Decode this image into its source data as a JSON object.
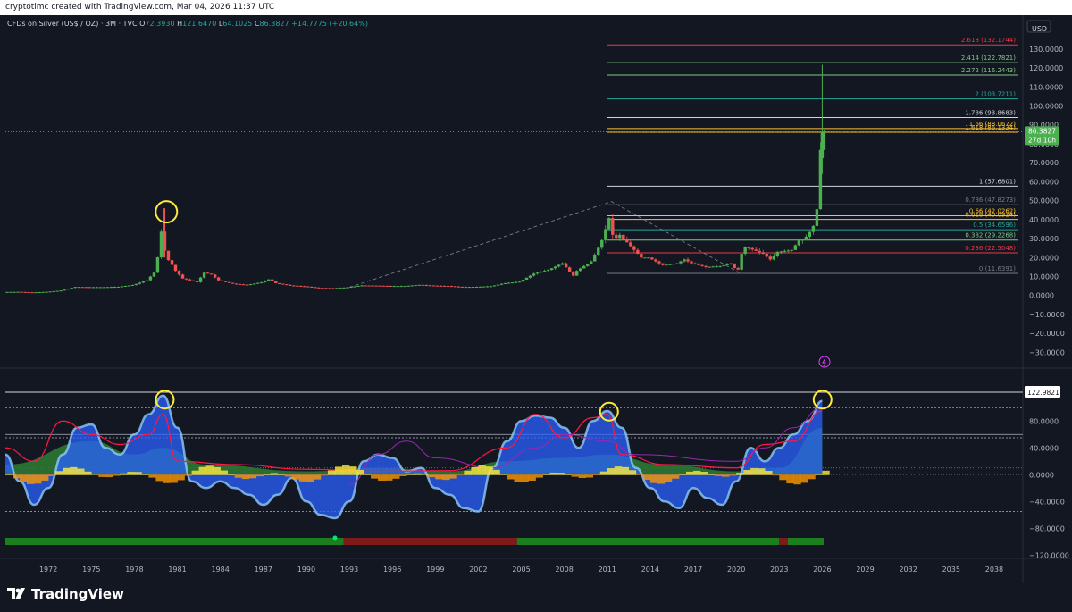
{
  "header": {
    "credit": "cryptotimc created with TradingView.com, Mar 04, 2026 11:37 UTC"
  },
  "symbol_line": {
    "name": "CFDs on Silver (US$ / OZ) · 3M · TVC",
    "o_label": "O",
    "o_value": "72.3930",
    "h_label": "H",
    "h_value": "121.6470",
    "l_label": "L",
    "l_value": "64.1025",
    "c_label": "C",
    "c_value": "86.3827",
    "change": "+14.7775 (+20.64%)"
  },
  "logo": {
    "text": "TradingView"
  },
  "colors": {
    "background": "#131722",
    "up": "#4caf50",
    "down": "#ef5350",
    "fib_red": "#f23645",
    "fib_green": "#81c784",
    "fib_teal": "#26a69a",
    "fib_yellow": "#fbc02d",
    "fib_white": "#d1d4dc",
    "fib_gray": "#787b86",
    "osc_blue": "#2962ff",
    "osc_lightblue": "#90caf9",
    "osc_green": "#4caf50",
    "osc_yellow": "#ffeb3b",
    "osc_red": "#ff1744",
    "osc_purple": "#9c27b0",
    "annotation": "#ffeb3b"
  },
  "chart_data": [
    {
      "type": "candlestick",
      "title": "CFDs on Silver (US$ / OZ) · 3M · TVC",
      "currency_label": "USD",
      "ylim": [
        -35,
        137
      ],
      "xlim": [
        1969.0,
        2040.0
      ],
      "y_ticks": [
        "130.0000",
        "120.0000",
        "110.0000",
        "100.0000",
        "90.0000",
        "80.0000",
        "70.0000",
        "60.0000",
        "50.0000",
        "40.0000",
        "30.0000",
        "20.0000",
        "10.0000",
        "0.0000",
        "−10.0000",
        "−20.0000",
        "−30.0000"
      ],
      "y_tick_values": [
        130,
        120,
        110,
        100,
        90,
        80,
        70,
        60,
        50,
        40,
        30,
        20,
        10,
        0,
        -10,
        -20,
        -30
      ],
      "last_price_label": "86.3827",
      "countdown_label": "27d 10h",
      "last_price": 86.3827,
      "series": [
        {
          "name": "price",
          "points": [
            [
              1969.0,
              1.8
            ],
            [
              1970.0,
              1.9
            ],
            [
              1971.0,
              1.6
            ],
            [
              1972.0,
              1.9
            ],
            [
              1973.0,
              2.6
            ],
            [
              1974.0,
              4.5
            ],
            [
              1975.0,
              4.4
            ],
            [
              1976.0,
              4.4
            ],
            [
              1977.0,
              4.6
            ],
            [
              1978.0,
              5.5
            ],
            [
              1979.0,
              8.0
            ],
            [
              1979.5,
              12.0
            ],
            [
              1979.9,
              25
            ],
            [
              1980.05,
              38
            ],
            [
              1980.3,
              20
            ],
            [
              1980.6,
              18
            ],
            [
              1981.0,
              13
            ],
            [
              1981.5,
              9
            ],
            [
              1982.0,
              8
            ],
            [
              1982.5,
              7
            ],
            [
              1983.0,
              12
            ],
            [
              1983.5,
              11
            ],
            [
              1984.0,
              8
            ],
            [
              1985.0,
              6.2
            ],
            [
              1986.0,
              5.6
            ],
            [
              1987.0,
              7.0
            ],
            [
              1987.5,
              8.5
            ],
            [
              1988.0,
              6.5
            ],
            [
              1989.0,
              5.3
            ],
            [
              1990.0,
              4.8
            ],
            [
              1991.0,
              4.0
            ],
            [
              1992.0,
              3.8
            ],
            [
              1993.0,
              4.3
            ],
            [
              1994.0,
              5.3
            ],
            [
              1995.0,
              5.2
            ],
            [
              1996.0,
              5.0
            ],
            [
              1997.0,
              5.0
            ],
            [
              1998.0,
              5.6
            ],
            [
              1999.0,
              5.2
            ],
            [
              2000.0,
              5.0
            ],
            [
              2001.0,
              4.5
            ],
            [
              2002.0,
              4.6
            ],
            [
              2003.0,
              4.9
            ],
            [
              2004.0,
              6.5
            ],
            [
              2005.0,
              7.3
            ],
            [
              2006.0,
              11.5
            ],
            [
              2007.0,
              13.5
            ],
            [
              2008.0,
              17
            ],
            [
              2008.8,
              10
            ],
            [
              2009.0,
              13
            ],
            [
              2010.0,
              18
            ],
            [
              2010.7,
              28
            ],
            [
              2011.0,
              35
            ],
            [
              2011.3,
              42
            ],
            [
              2011.5,
              32
            ],
            [
              2011.8,
              30
            ],
            [
              2012.0,
              32
            ],
            [
              2012.5,
              28
            ],
            [
              2013.0,
              24
            ],
            [
              2013.5,
              20
            ],
            [
              2014.0,
              20
            ],
            [
              2015.0,
              16
            ],
            [
              2016.0,
              17
            ],
            [
              2016.5,
              19
            ],
            [
              2017.0,
              17
            ],
            [
              2018.0,
              15
            ],
            [
              2019.0,
              15.5
            ],
            [
              2019.8,
              17
            ],
            [
              2020.2,
              12
            ],
            [
              2020.5,
              22
            ],
            [
              2020.8,
              26
            ],
            [
              2021.0,
              25
            ],
            [
              2022.0,
              22
            ],
            [
              2022.5,
              19
            ],
            [
              2023.0,
              23
            ],
            [
              2024.0,
              24
            ],
            [
              2024.5,
              29
            ],
            [
              2025.0,
              31
            ],
            [
              2025.3,
              34
            ],
            [
              2025.6,
              38
            ],
            [
              2025.8,
              48
            ],
            [
              2025.95,
              72
            ],
            [
              2026.1,
              86.3827
            ]
          ]
        }
      ],
      "fib_levels": [
        {
          "ratio": "2.618",
          "label": "2.618 (132.1744)",
          "value": 132.1744,
          "color": "#f23645"
        },
        {
          "ratio": "2.414",
          "label": "2.414 (122.7821)",
          "value": 122.7821,
          "color": "#81c784"
        },
        {
          "ratio": "2.272",
          "label": "2.272 (116.2443)",
          "value": 116.2443,
          "color": "#81c784"
        },
        {
          "ratio": "2",
          "label": "2 (103.7211)",
          "value": 103.7211,
          "color": "#26a69a"
        },
        {
          "ratio": "1.786",
          "label": "1.786 (93.8683)",
          "value": 93.8683,
          "color": "#d1d4dc"
        },
        {
          "ratio": "1.66",
          "label": "1.66 (88.0672)",
          "value": 88.0672,
          "color": "#fbc02d"
        },
        {
          "ratio": "1.618",
          "label": "1.618 (86.1334)",
          "value": 86.1334,
          "color": "#fbc02d"
        },
        {
          "ratio": "1",
          "label": "1 (57.6801)",
          "value": 57.6801,
          "color": "#d1d4dc"
        },
        {
          "ratio": "0.786",
          "label": "0.786 (47.8273)",
          "value": 47.8273,
          "color": "#787b86"
        },
        {
          "ratio": "0.66",
          "label": "0.66 (42.0262)",
          "value": 42.0262,
          "color": "#fbc02d"
        },
        {
          "ratio": "0.618",
          "label": "0.618 (40.0924)",
          "value": 40.0924,
          "color": "#fbc02d"
        },
        {
          "ratio": "0.5",
          "label": "0.5 (34.6596)",
          "value": 34.6596,
          "color": "#26a69a"
        },
        {
          "ratio": "0.382",
          "label": "0.382 (29.2268)",
          "value": 29.2268,
          "color": "#81c784"
        },
        {
          "ratio": "0.236",
          "label": "0.236 (22.5048)",
          "value": 22.5048,
          "color": "#f23645"
        },
        {
          "ratio": "0",
          "label": "0 (11.6391)",
          "value": 11.6391,
          "color": "#787b86"
        }
      ],
      "fib_x_range": [
        2011.0,
        2040.0
      ],
      "trend_line": [
        [
          1993.0,
          4.3
        ],
        [
          2011.3,
          49.5
        ],
        [
          2020.2,
          12.0
        ]
      ],
      "annotations": [
        {
          "type": "circle",
          "x": 1980.05,
          "y": 46
        }
      ]
    },
    {
      "type": "area",
      "title": "oscillator",
      "ylim": [
        -125,
        135
      ],
      "y_ticks": [
        "80.0000",
        "40.0000",
        "0.0000",
        "−40.0000",
        "−80.0000",
        "−120.0000"
      ],
      "y_tick_values": [
        80,
        40,
        0,
        -40,
        -80,
        -120
      ],
      "value_label": "122.9821",
      "value": 122.9821,
      "levels": [
        122.98,
        100,
        60,
        55,
        10,
        -55
      ],
      "series": [
        {
          "name": "wave",
          "points": [
            [
              1969,
              30
            ],
            [
              1970,
              -10
            ],
            [
              1971,
              -45
            ],
            [
              1972,
              -20
            ],
            [
              1973,
              30
            ],
            [
              1974,
              70
            ],
            [
              1975,
              75
            ],
            [
              1976,
              40
            ],
            [
              1977,
              30
            ],
            [
              1978,
              60
            ],
            [
              1979,
              90
            ],
            [
              1980,
              118
            ],
            [
              1981,
              70
            ],
            [
              1982,
              -10
            ],
            [
              1983,
              -20
            ],
            [
              1984,
              -10
            ],
            [
              1985,
              -20
            ],
            [
              1986,
              -30
            ],
            [
              1987,
              -45
            ],
            [
              1988,
              -30
            ],
            [
              1989,
              -5
            ],
            [
              1990,
              -40
            ],
            [
              1991,
              -60
            ],
            [
              1992,
              -65
            ],
            [
              1993,
              -40
            ],
            [
              1994,
              20
            ],
            [
              1995,
              30
            ],
            [
              1996,
              25
            ],
            [
              1997,
              5
            ],
            [
              1998,
              10
            ],
            [
              1999,
              -20
            ],
            [
              2000,
              -30
            ],
            [
              2001,
              -50
            ],
            [
              2002,
              -55
            ],
            [
              2003,
              10
            ],
            [
              2004,
              50
            ],
            [
              2005,
              80
            ],
            [
              2006,
              88
            ],
            [
              2007,
              85
            ],
            [
              2008,
              70
            ],
            [
              2009,
              40
            ],
            [
              2010,
              80
            ],
            [
              2011,
              95
            ],
            [
              2012,
              70
            ],
            [
              2013,
              10
            ],
            [
              2014,
              -20
            ],
            [
              2015,
              -40
            ],
            [
              2016,
              -50
            ],
            [
              2017,
              -20
            ],
            [
              2018,
              -35
            ],
            [
              2019,
              -45
            ],
            [
              2020,
              -10
            ],
            [
              2021,
              40
            ],
            [
              2022,
              20
            ],
            [
              2023,
              40
            ],
            [
              2024,
              60
            ],
            [
              2025,
              80
            ],
            [
              2026,
              110
            ]
          ]
        },
        {
          "name": "green",
          "points": [
            [
              1969,
              15
            ],
            [
              1975,
              50
            ],
            [
              1978,
              30
            ],
            [
              1980,
              40
            ],
            [
              1983,
              15
            ],
            [
              1990,
              5
            ],
            [
              1995,
              10
            ],
            [
              2000,
              5
            ],
            [
              2004,
              20
            ],
            [
              2008,
              25
            ],
            [
              2011,
              30
            ],
            [
              2015,
              15
            ],
            [
              2020,
              5
            ],
            [
              2023,
              10
            ],
            [
              2026,
              70
            ]
          ]
        },
        {
          "name": "red",
          "points": [
            [
              1969,
              40
            ],
            [
              1971,
              20
            ],
            [
              1973,
              80
            ],
            [
              1975,
              60
            ],
            [
              1977,
              45
            ],
            [
              1979,
              60
            ],
            [
              1980,
              90
            ],
            [
              1981,
              20
            ],
            [
              1985,
              15
            ],
            [
              1990,
              8
            ],
            [
              1995,
              5
            ],
            [
              2000,
              6
            ],
            [
              2004,
              40
            ],
            [
              2006,
              90
            ],
            [
              2008,
              55
            ],
            [
              2010,
              85
            ],
            [
              2011,
              90
            ],
            [
              2012,
              30
            ],
            [
              2015,
              15
            ],
            [
              2020,
              10
            ],
            [
              2022,
              45
            ],
            [
              2024,
              50
            ],
            [
              2026,
              95
            ]
          ]
        },
        {
          "name": "purple",
          "points": [
            [
              1993,
              -15
            ],
            [
              1995,
              30
            ],
            [
              1997,
              50
            ],
            [
              1999,
              25
            ],
            [
              2003,
              10
            ],
            [
              2006,
              40
            ],
            [
              2008,
              60
            ],
            [
              2011,
              50
            ],
            [
              2013,
              30
            ],
            [
              2020,
              20
            ],
            [
              2022,
              40
            ],
            [
              2024,
              70
            ],
            [
              2026,
              100
            ]
          ]
        }
      ],
      "bands": [
        {
          "x": [
            1969,
            1992.6
          ],
          "color": "#1b7e1f"
        },
        {
          "x": [
            1992.6,
            2004.7
          ],
          "color": "#7f1a1a"
        },
        {
          "x": [
            2004.7,
            2023.0
          ],
          "color": "#1b7e1f"
        },
        {
          "x": [
            2023.0,
            2023.6
          ],
          "color": "#7f1a1a"
        },
        {
          "x": [
            2023.6,
            2026.1
          ],
          "color": "#1b7e1f"
        }
      ],
      "annotations": [
        {
          "type": "circle",
          "x": 1980.0,
          "y": 116
        },
        {
          "type": "circle",
          "x": 2011.0,
          "y": 98
        },
        {
          "type": "circle",
          "x": 2025.9,
          "y": 116
        }
      ]
    }
  ],
  "x_axis": {
    "tick_labels": [
      "1972",
      "1975",
      "1978",
      "1981",
      "1984",
      "1987",
      "1990",
      "1993",
      "1996",
      "1999",
      "2002",
      "2005",
      "2008",
      "2011",
      "2014",
      "2017",
      "2020",
      "2023",
      "2026",
      "2029",
      "2032",
      "2035",
      "2038"
    ],
    "tick_values": [
      1972,
      1975,
      1978,
      1981,
      1984,
      1987,
      1990,
      1993,
      1996,
      1999,
      2002,
      2005,
      2008,
      2011,
      2014,
      2017,
      2020,
      2023,
      2026,
      2029,
      2032,
      2035,
      2038
    ]
  }
}
